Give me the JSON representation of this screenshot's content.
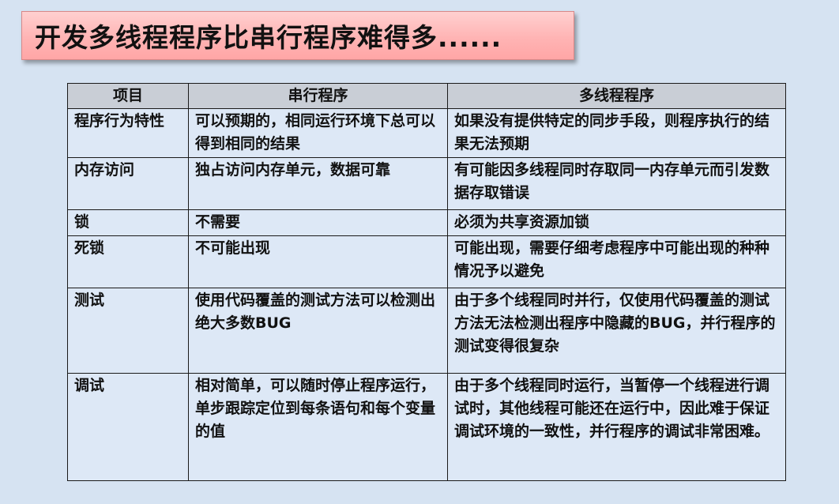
{
  "title": "开发多线程程序比串行程序难得多......",
  "table": {
    "headers": [
      "项目",
      "串行程序",
      "多线程程序"
    ],
    "rows": [
      {
        "item": "程序行为特性",
        "serial": "可以预期的，相同运行环境下总可以得到相同的结果",
        "multi": "如果没有提供特定的同步手段，则程序执行的结果无法预期"
      },
      {
        "item": "内存访问",
        "serial": "独占访问内存单元，数据可靠",
        "multi": "有可能因多线程同时存取同一内存单元而引发数据存取错误"
      },
      {
        "item": "锁",
        "serial": "不需要",
        "multi": "必须为共享资源加锁"
      },
      {
        "item": "死锁",
        "serial": "不可能出现",
        "multi": "可能出现，需要仔细考虑程序中可能出现的种种情况予以避免"
      },
      {
        "item": "测试",
        "serial": "使用代码覆盖的测试方法可以检测出绝大多数BUG",
        "multi": "由于多个线程同时并行，仅使用代码覆盖的测试方法无法检测出程序中隐藏的BUG，并行程序的测试变得很复杂"
      },
      {
        "item": "调试",
        "serial": "相对简单，可以随时停止程序运行，单步跟踪定位到每条语句和每个变量的值",
        "multi": "由于多个线程同时运行，当暂停一个线程进行调试时，其他线程可能还在运行中，因此难于保证调试环境的一致性，并行程序的调试非常困难。"
      }
    ]
  }
}
